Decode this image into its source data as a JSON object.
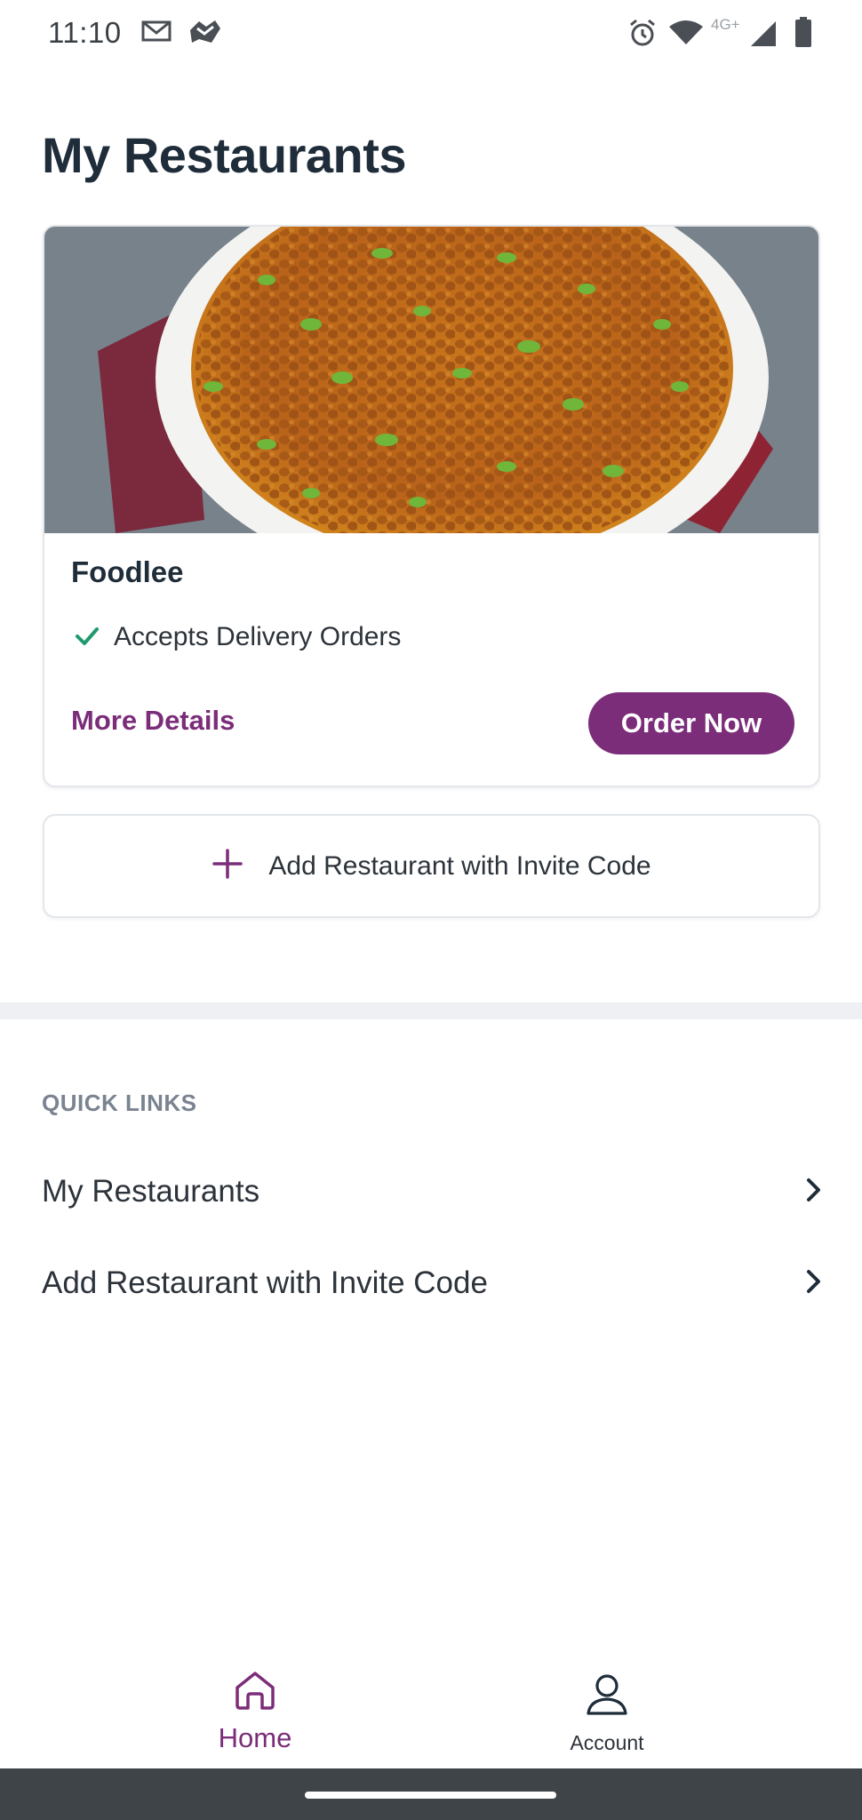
{
  "status_bar": {
    "time": "11:10",
    "network": "4G+",
    "left_icons": [
      "gmail-icon",
      "map-app-icon"
    ],
    "right_icons": [
      "alarm-icon",
      "wifi-icon",
      "signal-icon",
      "battery-icon"
    ]
  },
  "page": {
    "title": "My Restaurants"
  },
  "restaurant_card": {
    "name": "Foodlee",
    "image": "curry-dish-image",
    "status_icon": "check-icon",
    "status_text": "Accepts Delivery Orders",
    "more_details_label": "More Details",
    "order_now_label": "Order Now"
  },
  "add_restaurant": {
    "icon": "plus-icon",
    "label": "Add Restaurant with Invite Code"
  },
  "quick_links": {
    "header": "QUICK LINKS",
    "items": [
      {
        "label": "My Restaurants",
        "icon": "chevron-right-icon"
      },
      {
        "label": "Add Restaurant with Invite Code",
        "icon": "chevron-right-icon"
      }
    ]
  },
  "bottom_nav": {
    "items": [
      {
        "label": "Home",
        "icon": "home-icon",
        "active": true
      },
      {
        "label": "Account",
        "icon": "user-icon",
        "active": false
      }
    ]
  },
  "colors": {
    "accent": "#7b2d79",
    "check": "#1f9b6e",
    "title": "#1f2d3a",
    "muted": "#7a8390",
    "system_bar": "#3f4448"
  }
}
